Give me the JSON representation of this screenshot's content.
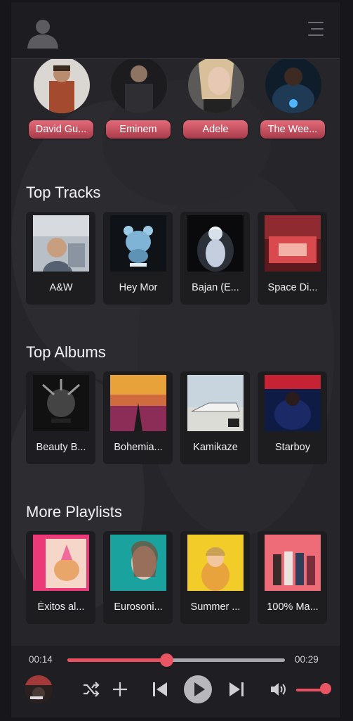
{
  "header": {
    "avatar_icon": "user-avatar-icon",
    "menu_icon": "hamburger-menu-icon"
  },
  "artists": [
    {
      "name": "David Gu...",
      "color": "#a44a2e"
    },
    {
      "name": "Eminem",
      "color": "#2a2a2d"
    },
    {
      "name": "Adele",
      "color": "#c9a98f"
    },
    {
      "name": "The Wee...",
      "color": "#1f3a55"
    }
  ],
  "sections": {
    "top_tracks": "Top Tracks",
    "top_albums": "Top Albums",
    "more_playlists": "More Playlists"
  },
  "top_tracks": [
    {
      "label": "A&W",
      "colors": [
        "#8e9aa6",
        "#d6d8dc"
      ]
    },
    {
      "label": "Hey Mor",
      "colors": [
        "#0f1216",
        "#7fb4d6"
      ]
    },
    {
      "label": "Bajan (E...",
      "colors": [
        "#0a0a0c",
        "#e9eef4"
      ]
    },
    {
      "label": "Space Di...",
      "colors": [
        "#5d1a1e",
        "#d94a4f"
      ]
    }
  ],
  "top_albums": [
    {
      "label": "Beauty B...",
      "colors": [
        "#111",
        "#888"
      ]
    },
    {
      "label": "Bohemia...",
      "colors": [
        "#e7a23a",
        "#8b2d56"
      ]
    },
    {
      "label": "Kamikaze",
      "colors": [
        "#dcdcd6",
        "#9fb8c6"
      ]
    },
    {
      "label": "Starboy",
      "colors": [
        "#0d1b45",
        "#c52233"
      ]
    }
  ],
  "playlists": [
    {
      "label": "Éxitos al...",
      "colors": [
        "#ec3a78",
        "#f2c7b2"
      ]
    },
    {
      "label": "Eurosoni...",
      "colors": [
        "#1aa39e",
        "#d9c6b4"
      ]
    },
    {
      "label": "Summer ...",
      "colors": [
        "#f2cd2a",
        "#e8a33d"
      ]
    },
    {
      "label": "100% Ma...",
      "colors": [
        "#c23a4e",
        "#ee6c77"
      ]
    }
  ],
  "player": {
    "current_time": "00:14",
    "total_time": "00:29",
    "progress": 0.455,
    "volume": 1.0,
    "accent": "#e8515f"
  }
}
